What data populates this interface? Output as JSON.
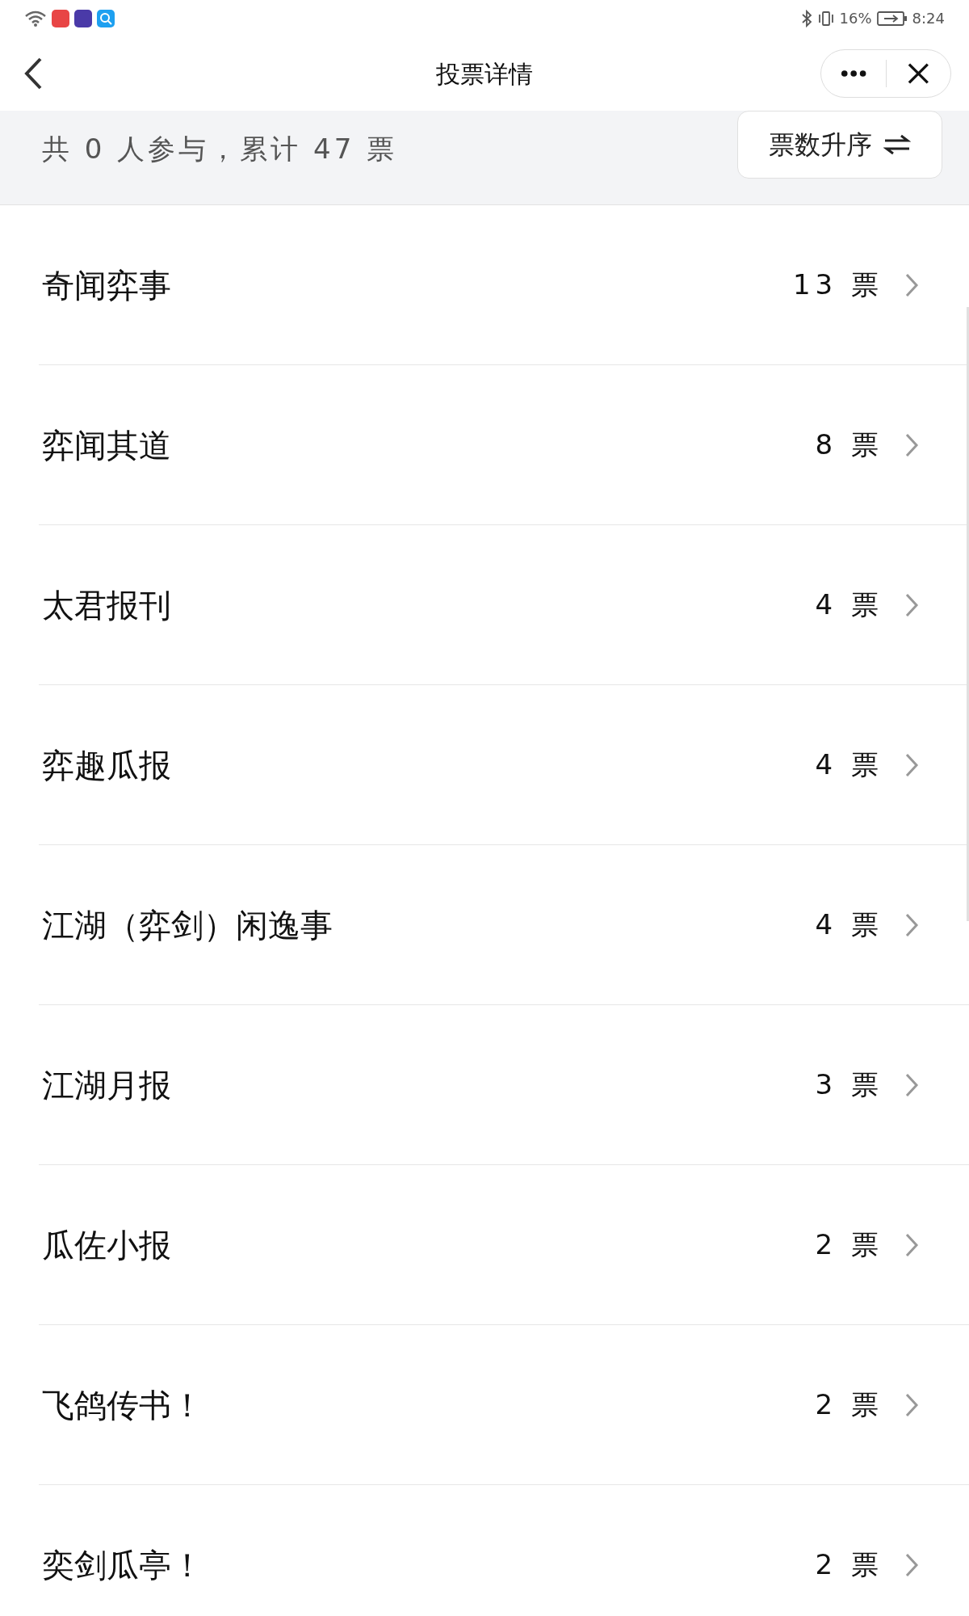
{
  "status_bar": {
    "battery": "16%",
    "time": "8:24"
  },
  "header": {
    "title": "投票详情"
  },
  "summary": {
    "text": "共 0 人参与，累计 47 票",
    "sort_button": "票数升序"
  },
  "items": [
    {
      "name": "奇闻弈事",
      "votes": "13 票"
    },
    {
      "name": "弈闻其道",
      "votes": "8 票"
    },
    {
      "name": "太君报刊",
      "votes": "4 票"
    },
    {
      "name": "弈趣瓜报",
      "votes": "4 票"
    },
    {
      "name": "江湖（弈剑）闲逸事",
      "votes": "4 票"
    },
    {
      "name": "江湖月报",
      "votes": "3 票"
    },
    {
      "name": "瓜佐小报",
      "votes": "2 票"
    },
    {
      "name": "飞鸽传书！",
      "votes": "2 票"
    },
    {
      "name": "奕剑瓜亭！",
      "votes": "2 票"
    }
  ]
}
